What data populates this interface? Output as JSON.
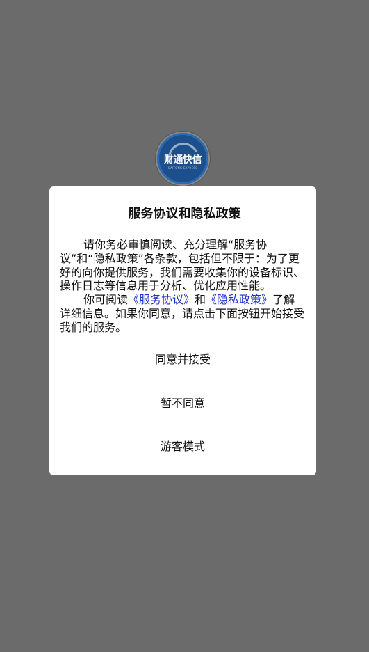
{
  "logo": {
    "text": "财通快信",
    "subtext": "CAITONG EXPRESS"
  },
  "dialog": {
    "title": "服务协议和隐私政策",
    "paragraph1": "请你务必审慎阅读、充分理解“服务协议”和“隐私政策”各条款，包括但不限于：为了更好的向你提供服务，我们需要收集你的设备标识、操作日志等信息用于分析、优化应用性能。",
    "paragraph2_prefix": "你可阅读",
    "service_agreement_link": "《服务协议》",
    "and_text": "和",
    "privacy_policy_link": "《隐私政策》",
    "paragraph2_suffix": "了解详细信息。如果你同意，请点击下面按钮开始接受我们的服务。",
    "accept_label": "同意并接受",
    "decline_label": "暂不同意",
    "guest_label": "游客模式",
    "link_color": "#1a2fc9"
  }
}
